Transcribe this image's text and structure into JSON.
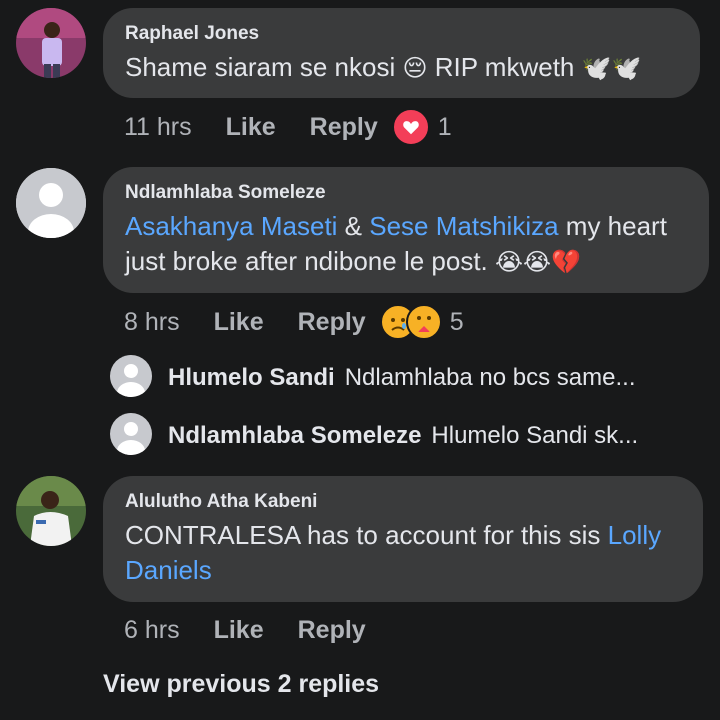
{
  "comments": [
    {
      "author": "Raphael Jones",
      "text_parts": [
        "Shame siaram se nkosi ",
        "😔",
        " RIP mkweth ",
        "🕊️🕊️"
      ],
      "time": "11 hrs",
      "like": "Like",
      "reply": "Reply",
      "reaction_count": "1",
      "reaction_icon": "heart-icon"
    },
    {
      "author": "Ndlamhlaba Someleze",
      "mention1": "Asakhanya Maseti",
      "amp": " & ",
      "mention2": "Sese Matshikiza",
      "text_after": " my heart just broke after ndibone le post. ",
      "emojis": "😭😭💔",
      "time": "8 hrs",
      "like": "Like",
      "reply": "Reply",
      "reaction_count": "5",
      "reaction_icons": [
        "sad-icon",
        "care-icon"
      ]
    },
    {
      "author": "Alulutho Atha Kabeni",
      "text_before": "CONTRALESA has to account for this sis ",
      "mention": "Lolly Daniels",
      "time": "6 hrs",
      "like": "Like",
      "reply": "Reply"
    }
  ],
  "replies": [
    {
      "author": "Hlumelo Sandi",
      "text": "Ndlamhlaba no bcs same..."
    },
    {
      "author": "Ndlamhlaba Someleze",
      "text": "Hlumelo Sandi sk..."
    }
  ],
  "view_previous": "View previous 2 replies",
  "colors": {
    "background": "#18191a",
    "bubble": "#3a3b3c",
    "mention": "#5aa7ff",
    "secondary_text": "#b0b3b8",
    "heart_reaction": "#f33e58"
  }
}
